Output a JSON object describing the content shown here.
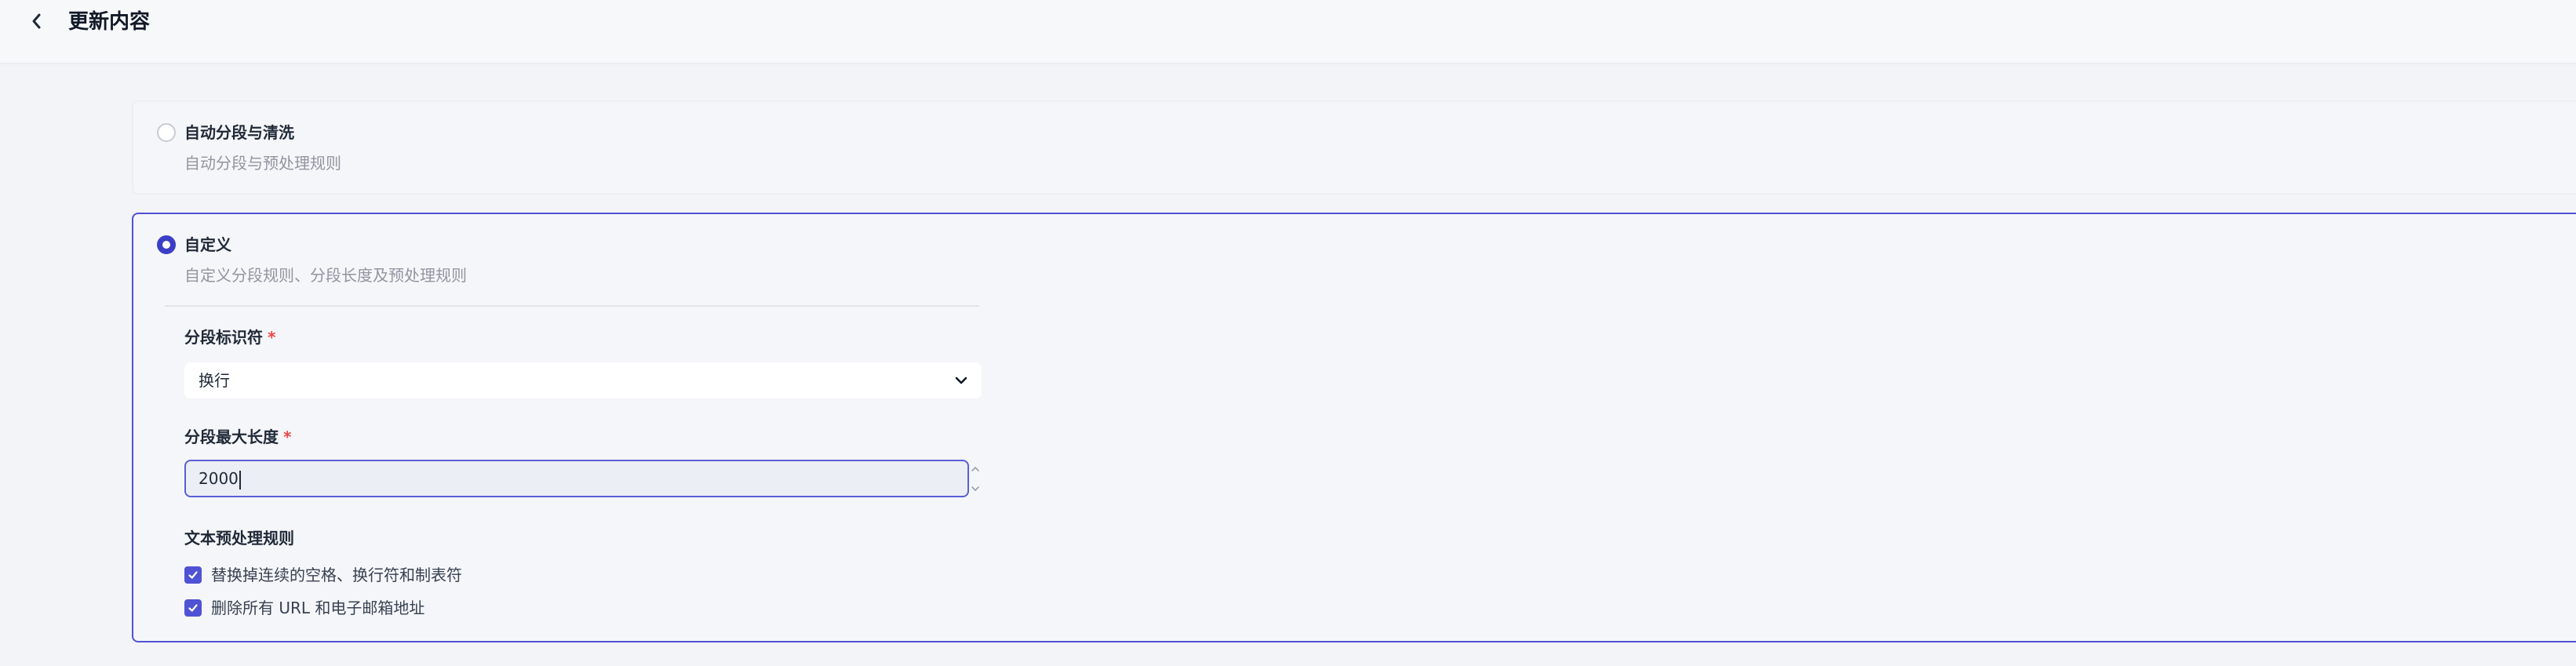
{
  "header": {
    "title": "更新内容"
  },
  "options": {
    "auto": {
      "title": "自动分段与清洗",
      "description": "自动分段与预处理规则",
      "selected": false
    },
    "custom": {
      "title": "自定义",
      "description": "自定义分段规则、分段长度及预处理规则",
      "selected": true,
      "segment_identifier": {
        "label": "分段标识符",
        "required_mark": "*",
        "value": "换行"
      },
      "max_length": {
        "label": "分段最大长度",
        "required_mark": "*",
        "value": "2000"
      },
      "preprocess": {
        "label": "文本预处理规则",
        "rules": [
          {
            "label": "替换掉连续的空格、换行符和制表符",
            "checked": true
          },
          {
            "label": "删除所有 URL 和电子邮箱地址",
            "checked": true
          }
        ]
      }
    }
  },
  "colors": {
    "accent": "#4f52d4",
    "required": "#ef4444",
    "muted_text": "#9095a0"
  },
  "icons": {
    "back": "chevron-left-icon",
    "select": "chevron-down-icon",
    "step_up": "chevron-up-icon",
    "step_down": "chevron-down-icon",
    "check": "check-icon"
  }
}
